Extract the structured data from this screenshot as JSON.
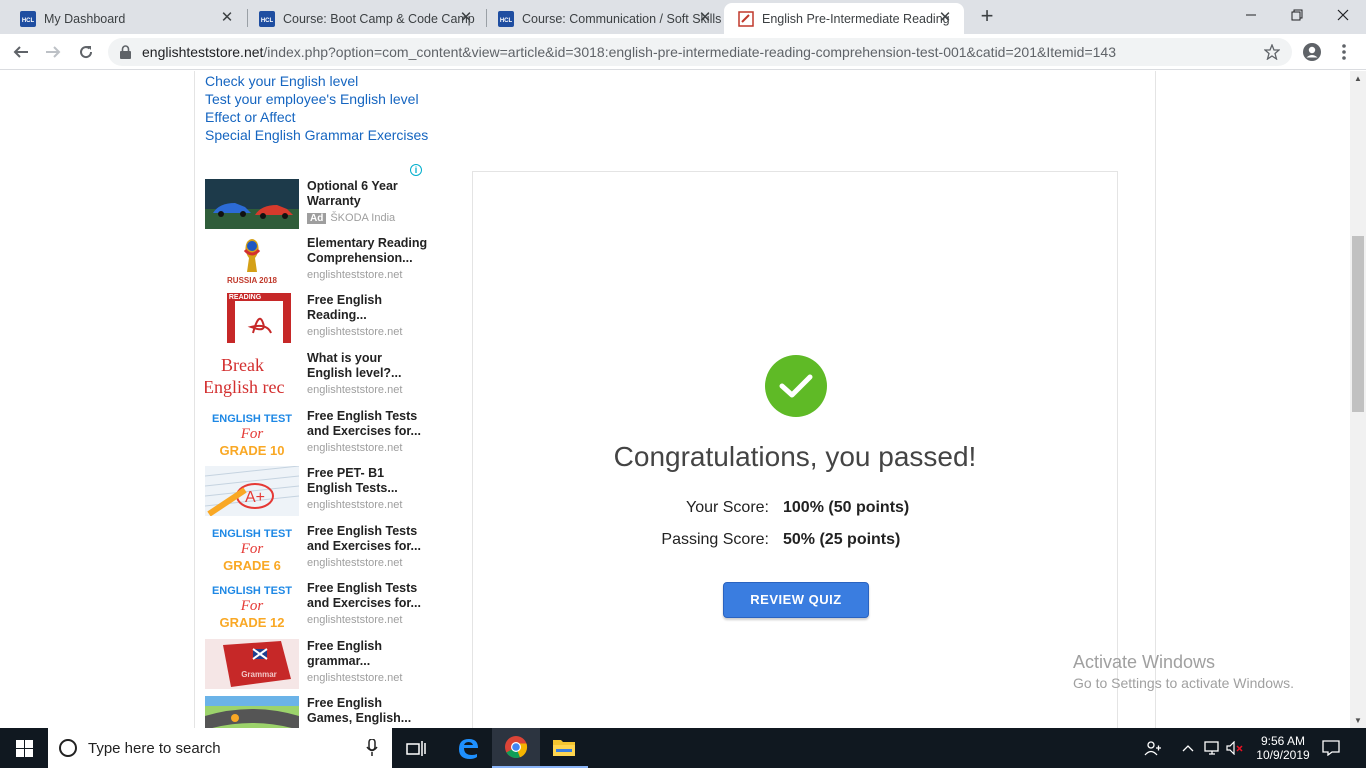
{
  "browser": {
    "tabs": [
      {
        "title": "My Dashboard",
        "favicon": "hcl-favicon",
        "active": false
      },
      {
        "title": "Course: Boot Camp & Code Camp",
        "favicon": "hcl-favicon",
        "active": false
      },
      {
        "title": "Course: Communication / Soft Skills",
        "favicon": "hcl-favicon",
        "active": false
      },
      {
        "title": "English Pre-Intermediate Reading",
        "favicon": "ets-favicon",
        "active": true
      }
    ],
    "new_tab": "+",
    "url_host": "englishteststore.net",
    "url_path": "/index.php?option=com_content&view=article&id=3018:english-pre-intermediate-reading-comprehension-test-001&catid=201&Itemid=143"
  },
  "sidebar": {
    "links": [
      "Check your English level",
      "Test your employee's English level",
      "Effect or Affect",
      "Special English Grammar Exercises"
    ],
    "ad_info": "i",
    "ads": [
      {
        "title": "Optional 6 Year Warranty",
        "source": "ŠKODA India",
        "badge": "Ad",
        "thumb": "car-ad-thumb"
      },
      {
        "title": "Elementary Reading Comprehension...",
        "source": "englishteststore.net",
        "thumb": "world-cup-russia-2018-thumb",
        "thumb_text": "RUSSIA 2018"
      },
      {
        "title": "Free English Reading...",
        "source": "englishteststore.net",
        "thumb": "reading-pdf-thumb",
        "thumb_text": "READING"
      },
      {
        "title": "What is your English level?...",
        "source": "englishteststore.net",
        "thumb": "break-english-thumb",
        "thumb_text": "Break English rec"
      },
      {
        "title": "Free English Tests and Exercises for...",
        "source": "englishteststore.net",
        "thumb": "grade-10-thumb",
        "thumb_text": [
          "ENGLISH TEST",
          "For",
          "GRADE 10"
        ]
      },
      {
        "title": "Free PET- B1 English Tests...",
        "source": "englishteststore.net",
        "thumb": "a-plus-test-thumb",
        "thumb_text": "A+"
      },
      {
        "title": "Free English Tests and Exercises for...",
        "source": "englishteststore.net",
        "thumb": "grade-6-thumb",
        "thumb_text": [
          "ENGLISH TEST",
          "For",
          "GRADE 6"
        ]
      },
      {
        "title": "Free English Tests and Exercises for...",
        "source": "englishteststore.net",
        "thumb": "grade-12-thumb",
        "thumb_text": [
          "ENGLISH TEST",
          "For",
          "GRADE 12"
        ]
      },
      {
        "title": "Free English grammar...",
        "source": "englishteststore.net",
        "thumb": "grammar-book-thumb",
        "thumb_text": "Grammar"
      },
      {
        "title": "Free English Games, English...",
        "source": "",
        "thumb": "games-thumb"
      }
    ]
  },
  "quiz": {
    "result_icon": "check-icon",
    "message": "Congratulations, you passed!",
    "your_score_label": "Your Score:",
    "your_score_value": "100% (50 points)",
    "passing_score_label": "Passing Score:",
    "passing_score_value": "50% (25 points)",
    "review_button": "REVIEW QUIZ",
    "accent_color": "#5fba26",
    "button_color": "#3a7de0"
  },
  "watermark": {
    "line1": "Activate Windows",
    "line2": "Go to Settings to activate Windows."
  },
  "taskbar": {
    "search_placeholder": "Type here to search",
    "time": "9:56 AM",
    "date": "10/9/2019"
  }
}
